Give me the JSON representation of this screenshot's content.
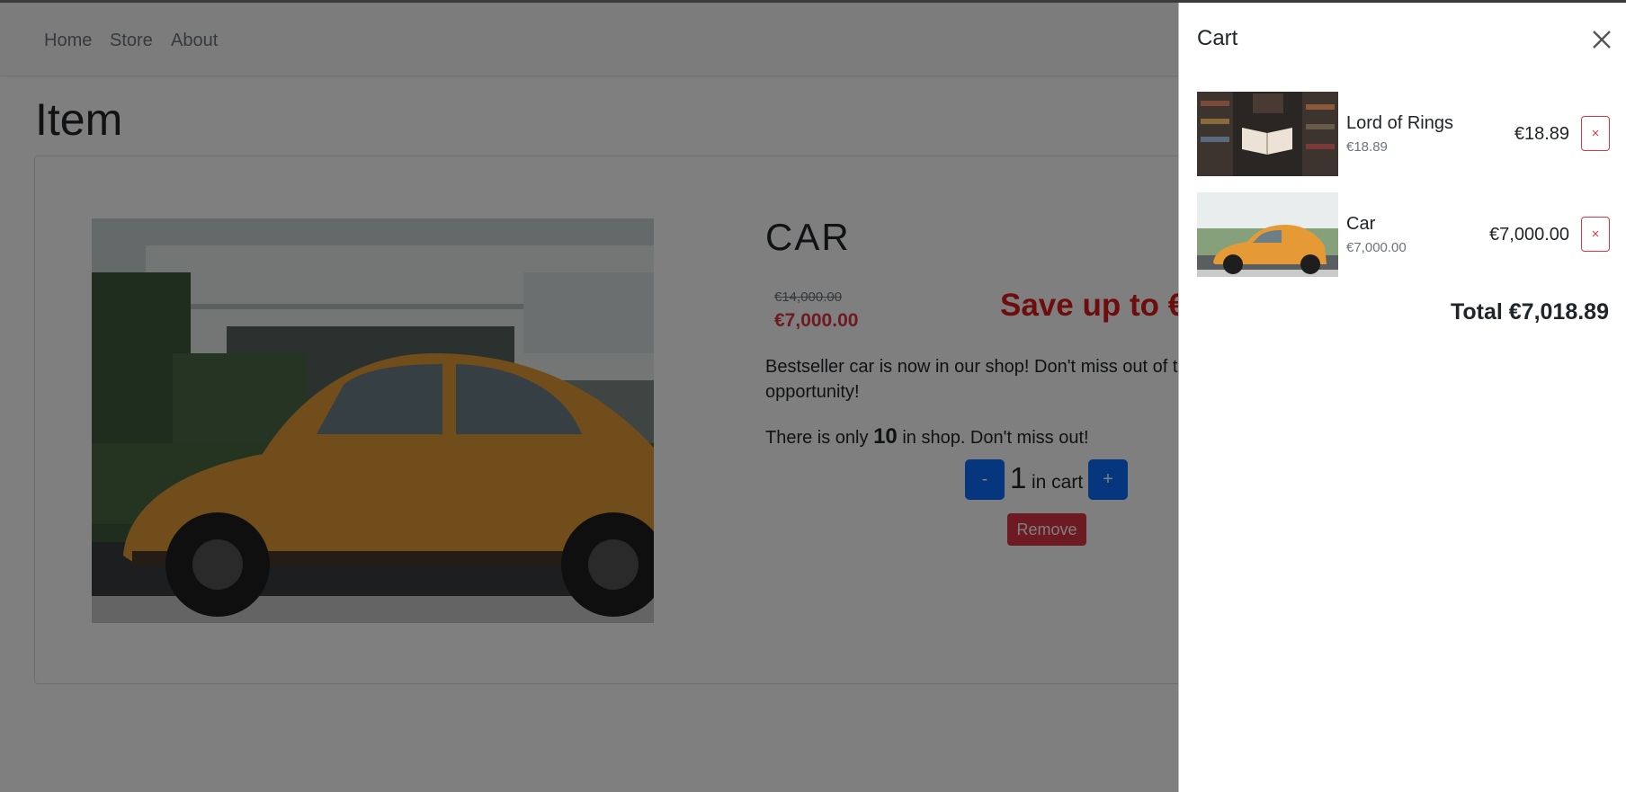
{
  "nav": {
    "links": [
      "Home",
      "Store",
      "About"
    ]
  },
  "page": {
    "title": "Item"
  },
  "item": {
    "name": "CAR",
    "image_icon": "car-photo",
    "old_price": "€14,000.00",
    "new_price": "€7,000.00",
    "save_text": "Save up to €",
    "description": "Bestseller car is now in our shop! Don't miss out of t opportunity!",
    "stock_prefix": "There is only",
    "stock_count": "10",
    "stock_suffix": "in shop. Don't miss out!",
    "decrement_label": "-",
    "quantity": "1",
    "quantity_label": "in cart",
    "increment_label": "+",
    "remove_label": "Remove"
  },
  "cart": {
    "title": "Cart",
    "close_icon": "close-icon",
    "items": [
      {
        "name": "Lord of Rings",
        "unit_price": "€18.89",
        "price": "€18.89",
        "remove_label": "×",
        "image_icon": "library-book-photo"
      },
      {
        "name": "Car",
        "unit_price": "€7,000.00",
        "price": "€7,000.00",
        "remove_label": "×",
        "image_icon": "car-photo"
      }
    ],
    "total": "Total €7,018.89"
  },
  "colors": {
    "primary": "#0d6efd",
    "danger": "#dc3545",
    "save_red": "#dc1a1a",
    "backdrop": "rgba(0,0,0,0.5)"
  }
}
